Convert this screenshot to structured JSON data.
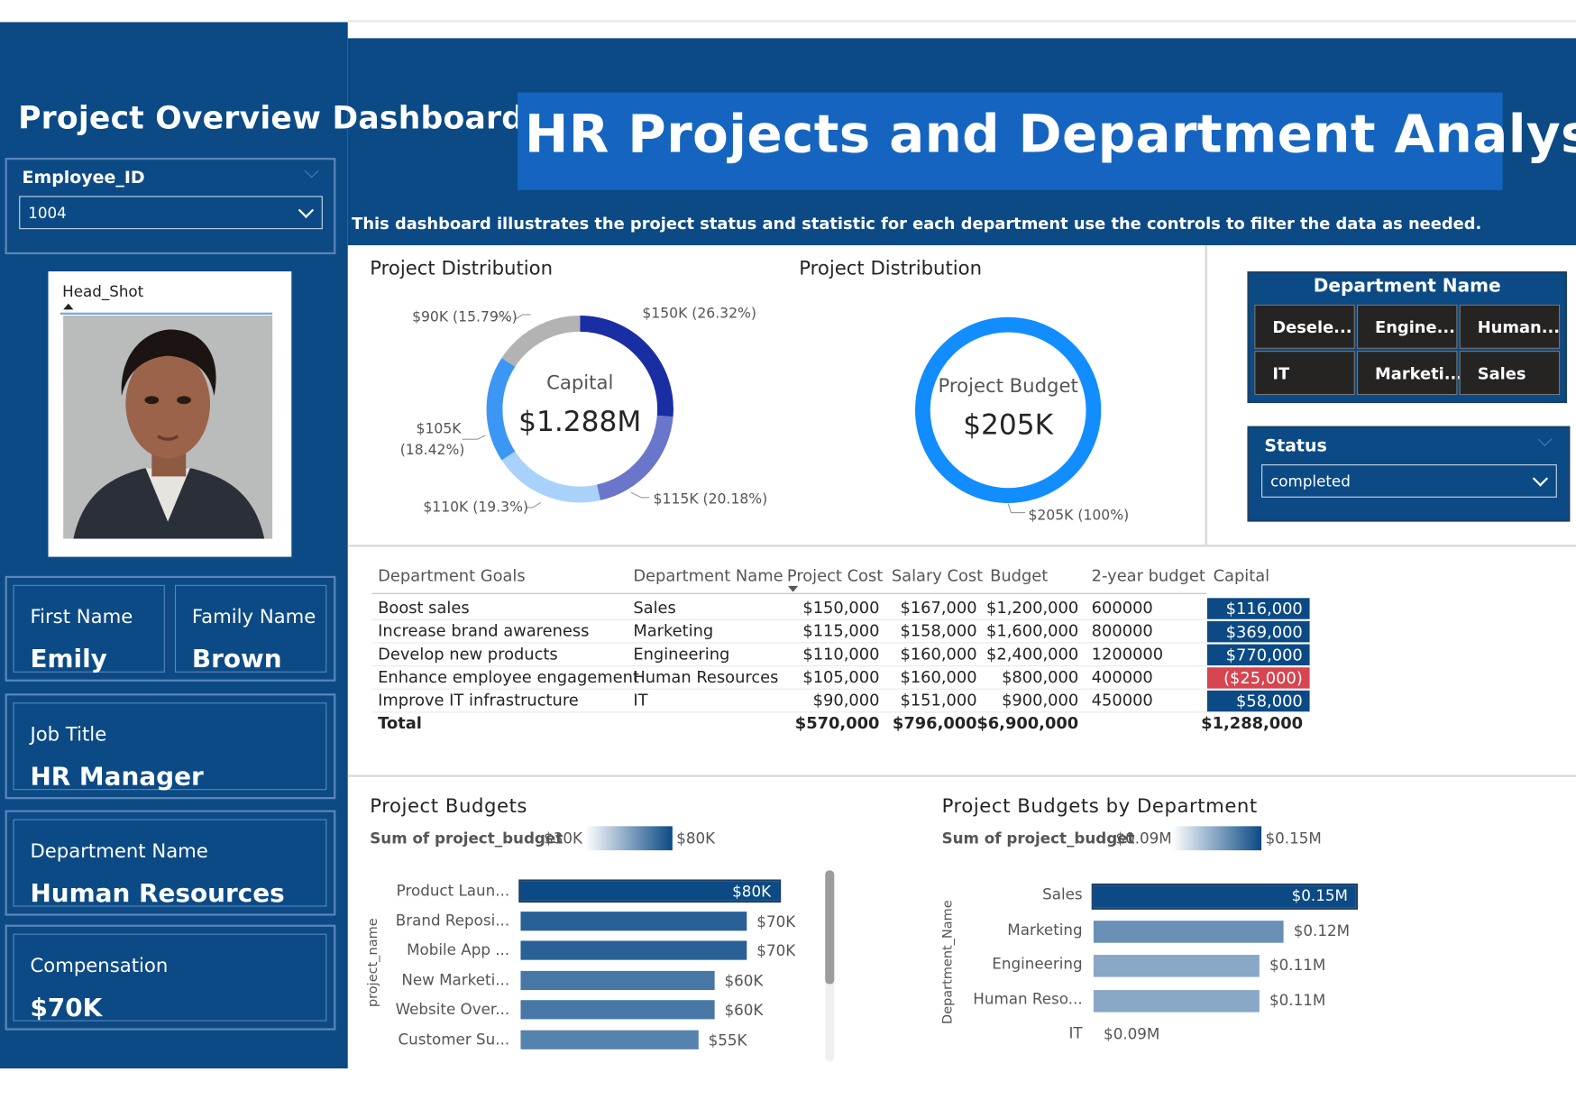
{
  "header": {
    "dashboard_title": "Project Overview Dashboard",
    "main_title": "HR Projects and Department Analysis",
    "subtitle": "This dashboard illustrates the project status and statistic for each department use the controls to filter the data as needed."
  },
  "filters": {
    "employee_id": {
      "label": "Employee_ID",
      "value": "1004"
    },
    "status": {
      "label": "Status",
      "value": "completed"
    },
    "department": {
      "label": "Department Name",
      "tiles": [
        "Desele...",
        "Engine...",
        "Human...",
        "IT",
        "Marketi...",
        "Sales"
      ]
    }
  },
  "profile": {
    "photo_label": "Head_Shot",
    "first_name_label": "First Name",
    "first_name": "Emily",
    "family_name_label": "Family Name",
    "family_name": "Brown",
    "job_title_label": "Job Title",
    "job_title": "HR Manager",
    "department_label": "Department Name",
    "department": "Human Resources",
    "compensation_label": "Compensation",
    "compensation": "$70K"
  },
  "donut_capital": {
    "title": "Project Distribution",
    "center_label": "Capital",
    "center_value": "$1.288M",
    "slices": [
      {
        "label": "$150K (26.32%)",
        "share": 26.32,
        "color": "#1a2ea3"
      },
      {
        "label": "$115K (20.18%)",
        "share": 20.18,
        "color": "#6a76c9"
      },
      {
        "label": "$110K (19.3%)",
        "share": 19.3,
        "color": "#a9d2fb"
      },
      {
        "label_line1": "$105K",
        "label_line2": "(18.42%)",
        "share": 18.42,
        "color": "#3b97f3"
      },
      {
        "label": "$90K (15.79%)",
        "share": 15.79,
        "color": "#b3b3b3"
      }
    ]
  },
  "donut_budget": {
    "title": "Project Distribution",
    "center_label": "Project Budget",
    "center_value": "$205K",
    "slice_label": "$205K (100%)",
    "color": "#118dff"
  },
  "table": {
    "headers": [
      "Department Goals",
      "Department Name",
      "Project Cost",
      "Salary Cost",
      "Budget",
      "2-year budget",
      "Capital"
    ],
    "rows": [
      {
        "goal": "Boost sales",
        "dept": "Sales",
        "project_cost": "$150,000",
        "salary_cost": "$167,000",
        "budget": "$1,200,000",
        "two_year": "600000",
        "capital": "$116,000"
      },
      {
        "goal": "Increase brand awareness",
        "dept": "Marketing",
        "project_cost": "$115,000",
        "salary_cost": "$158,000",
        "budget": "$1,600,000",
        "two_year": "800000",
        "capital": "$369,000"
      },
      {
        "goal": "Develop new products",
        "dept": "Engineering",
        "project_cost": "$110,000",
        "salary_cost": "$160,000",
        "budget": "$2,400,000",
        "two_year": "1200000",
        "capital": "$770,000"
      },
      {
        "goal": "Enhance employee engagement",
        "dept": "Human Resources",
        "project_cost": "$105,000",
        "salary_cost": "$160,000",
        "budget": "$800,000",
        "two_year": "400000",
        "capital": "($25,000)"
      },
      {
        "goal": "Improve IT infrastructure",
        "dept": "IT",
        "project_cost": "$90,000",
        "salary_cost": "$151,000",
        "budget": "$900,000",
        "two_year": "450000",
        "capital": "$58,000"
      }
    ],
    "total": {
      "label": "Total",
      "project_cost": "$570,000",
      "salary_cost": "$796,000",
      "budget": "$6,900,000",
      "capital": "$1,288,000"
    },
    "colors": {
      "capital_positive": "#0b4a85",
      "capital_negative": "#d64550"
    }
  },
  "chart_data": [
    {
      "type": "bar",
      "orientation": "horizontal",
      "title": "Project Budgets",
      "legend_label": "Sum of project_budget",
      "legend_min": "$30K",
      "legend_max": "$80K",
      "ylabel": "project_name",
      "categories": [
        "Product Laun...",
        "Brand Reposi...",
        "Mobile App ...",
        "New Marketi...",
        "Website Over...",
        "Customer Su..."
      ],
      "values": [
        80,
        70,
        70,
        60,
        60,
        55
      ],
      "value_labels": [
        "$80K",
        "$70K",
        "$70K",
        "$60K",
        "$60K",
        "$55K"
      ],
      "unit": "K",
      "xlim": [
        0,
        80
      ]
    },
    {
      "type": "bar",
      "orientation": "horizontal",
      "title": "Project Budgets by Department",
      "legend_label": "Sum of project_budget",
      "legend_min": "$0.09M",
      "legend_max": "$0.15M",
      "ylabel": "Department_Name",
      "categories": [
        "Sales",
        "Marketing",
        "Engineering",
        "Human Reso...",
        "IT"
      ],
      "values": [
        0.15,
        0.12,
        0.11,
        0.11,
        0.09
      ],
      "value_labels": [
        "$0.15M",
        "$0.12M",
        "$0.11M",
        "$0.11M",
        "$0.09M"
      ],
      "unit": "M",
      "xlim": [
        0.09,
        0.15
      ]
    }
  ]
}
